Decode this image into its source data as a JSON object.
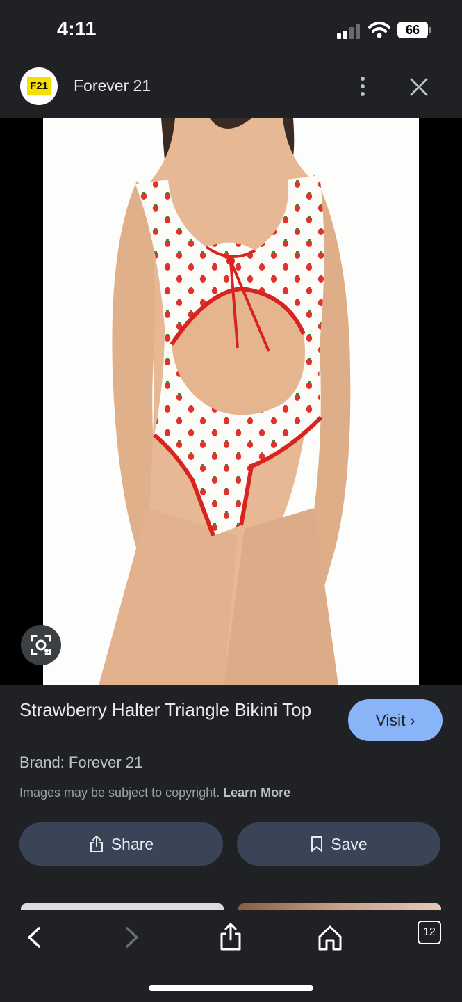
{
  "status_bar": {
    "time": "4:11",
    "battery": "66"
  },
  "header": {
    "logo_text": "F21",
    "site_name": "Forever 21"
  },
  "product": {
    "title": "Strawberry Halter Triangle Bikini Top",
    "brand": "Brand: Forever 21",
    "visit_label": "Visit",
    "copyright_text": "Images may be subject to copyright.",
    "learn_more": "Learn More"
  },
  "actions": {
    "share_label": "Share",
    "save_label": "Save"
  },
  "toolbar": {
    "tabs_count": "12"
  },
  "icons": [
    "signal-icon",
    "wifi-icon",
    "battery-icon",
    "more-vert-icon",
    "close-icon",
    "lens-icon",
    "share-icon",
    "bookmark-icon",
    "back-icon",
    "forward-icon",
    "ios-share-icon",
    "home-icon",
    "tabs-icon"
  ]
}
